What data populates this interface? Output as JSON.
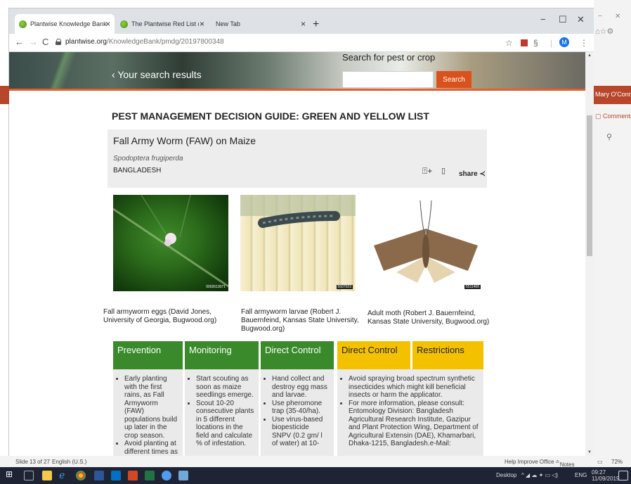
{
  "browser": {
    "tabs": [
      {
        "title": "Plantwise Knowledge Bank"
      },
      {
        "title": "The Plantwise Red List of Pestici"
      },
      {
        "title": "New Tab"
      }
    ],
    "url_host": "plantwise.org",
    "url_path": "/KnowledgeBank/pmdg/20197800348",
    "avatar_letter": "M"
  },
  "banner": {
    "back_label": "Your search results",
    "search_label": "Search for pest or crop",
    "search_placeholder": "",
    "search_button": "Search"
  },
  "page": {
    "heading": "PEST MANAGEMENT DECISION GUIDE: GREEN AND YELLOW LIST",
    "pest_title": "Fall Army Worm (FAW) on Maize",
    "latin_name": "Spodoptera frugiperda",
    "country": "BANGLADESH",
    "share_label": "share",
    "photos": [
      {
        "caption": "Fall armyworm eggs (David Jones, University of Georgia, Bugwood.org)",
        "badge": "0002613071"
      },
      {
        "caption": "Fall armyworm larvae (Robert J. Bauernfeind, Kansas State University, Bugwood.org)",
        "badge": "5507023"
      },
      {
        "caption": "Adult moth (Robert J. Bauernfeind, Kansas State University, Bugwood.org)",
        "badge": "5511466"
      }
    ],
    "columns": [
      {
        "header": "Prevention",
        "color": "#3a8a2b",
        "items": [
          "Early planting with the first rains, as Fall Armyworm (FAW) populations build up later in the crop season.",
          "Avoid planting at different times as"
        ]
      },
      {
        "header": "Monitoring",
        "color": "#3a8a2b",
        "items": [
          "Start scouting as soon as maize seedlings emerge.",
          "Scout 10-20 consecutive plants in 5 different locations in the field and calculate % of infestation."
        ]
      },
      {
        "header": "Direct Control",
        "color": "#3a8a2b",
        "items": [
          "Hand collect and destroy egg mass and larvae.",
          "Use pheromone trap (35-40/ha).",
          "Use virus-based biopesticide SNPV (0.2 gm/ l of water) at 10-"
        ]
      },
      {
        "header": "Direct Control",
        "color": "#f3c100",
        "items": []
      },
      {
        "header": "Restrictions",
        "color": "#f3c100",
        "items": [
          "Avoid spraying broad spectrum synthetic insecticides which might kill beneficial insects or harm the applicator.",
          "For more information, please consult: Entomology Division: Bangladesh Agricultural Research Institute, Gazipur and Plant Protection Wing, Department of Agricultural Extensin (DAE), Khamarbari, Dhaka-1215, Bangladesh.e-Mail:"
        ]
      }
    ]
  },
  "ppt": {
    "user": "Mary O'Connor",
    "comments_label": "Comments"
  },
  "statusbar": {
    "slide": "Slide 13 of 27",
    "language": "English (U.S.)",
    "help": "Help Improve Office",
    "notes": "Notes",
    "zoom": "72%"
  },
  "taskbar": {
    "desktop": "Desktop",
    "lang": "ENG",
    "time": "09:27",
    "date": "11/09/2019"
  }
}
